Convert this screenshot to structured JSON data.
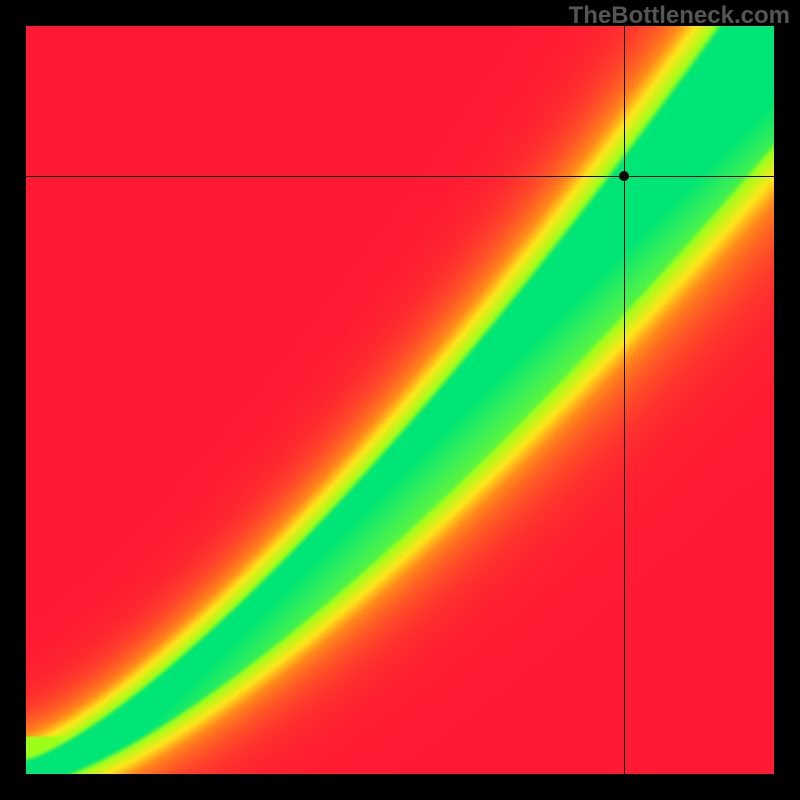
{
  "watermark": "TheBottleneck.com",
  "chart_data": {
    "type": "heatmap",
    "title": "",
    "xlabel": "",
    "ylabel": "",
    "xrange": [
      0,
      1
    ],
    "yrange": [
      0,
      1
    ],
    "marker": {
      "x": 0.8,
      "y": 0.8
    },
    "crosshair": {
      "x": 0.8,
      "y": 0.8
    },
    "description": "2D heatmap of bottleneck percentage vs two axes. Green diagonal band indicates balanced region; red corners indicate heavy bottleneck. Black crosshair and dot mark the selected CPU/GPU configuration.",
    "colorscale": [
      {
        "stop": 0.0,
        "color": "#ff1a33"
      },
      {
        "stop": 0.4,
        "color": "#ff8a1a"
      },
      {
        "stop": 0.6,
        "color": "#ffe61a"
      },
      {
        "stop": 0.9,
        "color": "#9cff1a"
      },
      {
        "stop": 1.0,
        "color": "#00e676"
      }
    ]
  }
}
